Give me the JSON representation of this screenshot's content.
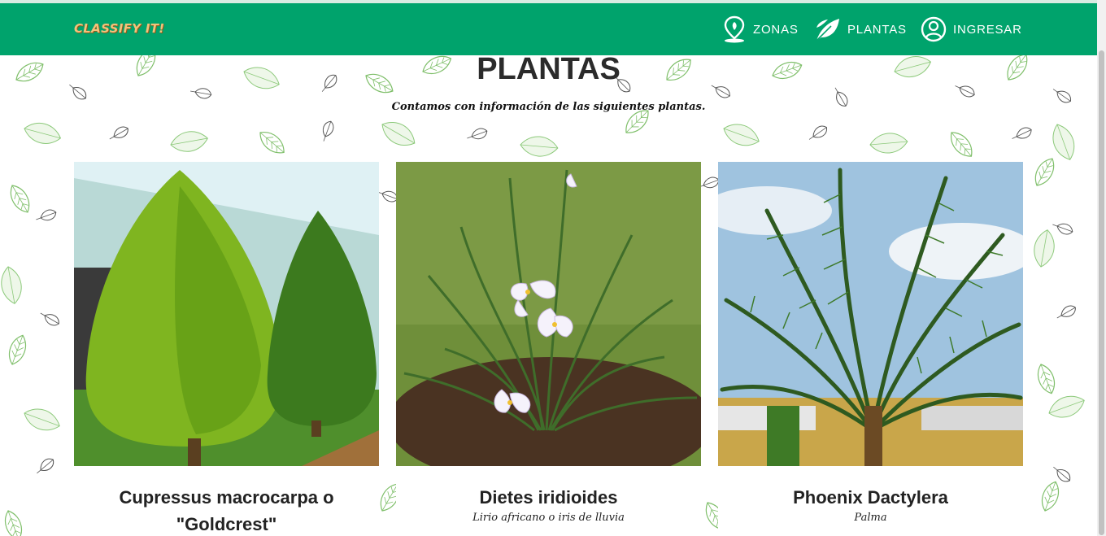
{
  "brand": "CLASSIFY IT!",
  "nav": {
    "zonas": "ZONAS",
    "plantas": "PLANTAS",
    "ingresar": "INGRESAR"
  },
  "page": {
    "title": "PLANTAS",
    "subtitle": "Contamos con información de las siguientes plantas."
  },
  "plants": [
    {
      "name": "Cupressus macrocarpa o \"Goldcrest\"",
      "common": ""
    },
    {
      "name": "Dietes iridioides",
      "common": "Lirio africano o iris de lluvia"
    },
    {
      "name": "Phoenix Dactylera",
      "common": "Palma"
    }
  ],
  "colors": {
    "navbar": "#00a36c",
    "leaf_pattern": "#7fbf6a"
  },
  "icons": [
    "location-pin-icon",
    "leaf-icon",
    "user-circle-icon"
  ]
}
